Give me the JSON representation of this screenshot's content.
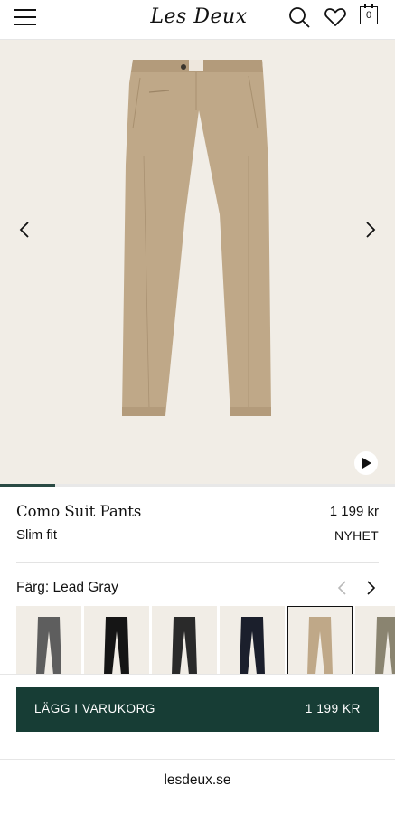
{
  "header": {
    "logo": "Les Deux",
    "menu_icon": "hamburger-menu-icon",
    "search_icon": "search-icon",
    "wishlist_icon": "heart-icon",
    "cart_icon": "shopping-bag-icon",
    "cart_count": "0"
  },
  "gallery": {
    "prev_icon": "chevron-left-icon",
    "next_icon": "chevron-right-icon",
    "play_icon": "play-icon",
    "progress": 0.14,
    "background": "#f1ede6"
  },
  "product": {
    "name": "Como Suit Pants",
    "price": "1 199 kr",
    "fit": "Slim fit",
    "badge": "NYHET"
  },
  "colors": {
    "label": "Färg: Lead Gray",
    "swatches": [
      {
        "color": "#5e5e5e",
        "selected": false
      },
      {
        "color": "#151515",
        "selected": false
      },
      {
        "color": "#2a2a2a",
        "selected": false
      },
      {
        "color": "#1b1f2c",
        "selected": false
      },
      {
        "color": "#bfa888",
        "selected": true
      },
      {
        "color": "#8a8470",
        "selected": false
      }
    ]
  },
  "cta": {
    "label": "LÄGG I VARUKORG",
    "price": "1 199 KR",
    "color": "#173d35"
  },
  "footer": {
    "url": "lesdeux.se"
  }
}
